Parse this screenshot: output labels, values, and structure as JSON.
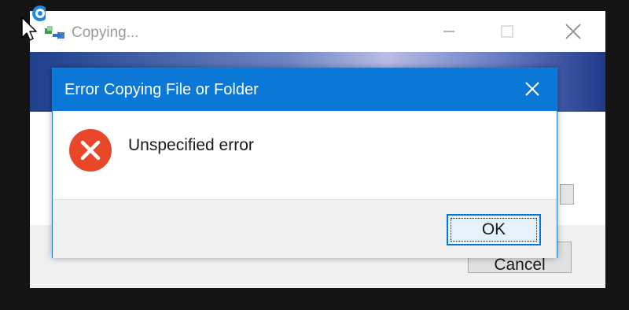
{
  "background_window": {
    "title": "Copying...",
    "cancel_label": "Cancel",
    "icons": [
      "copy-icon",
      "minimize-icon",
      "maximize-icon",
      "close-icon"
    ]
  },
  "dialog": {
    "title": "Error Copying File or Folder",
    "message": "Unspecified error",
    "ok_label": "OK",
    "icons": [
      "close-icon",
      "error-icon"
    ]
  },
  "colors": {
    "dialog_titlebar": "#0b78d7",
    "error_icon": "#e8472a",
    "ok_border": "#0078d7",
    "banner_dark": "#1f3f8c",
    "banner_light": "#b9bce6"
  }
}
